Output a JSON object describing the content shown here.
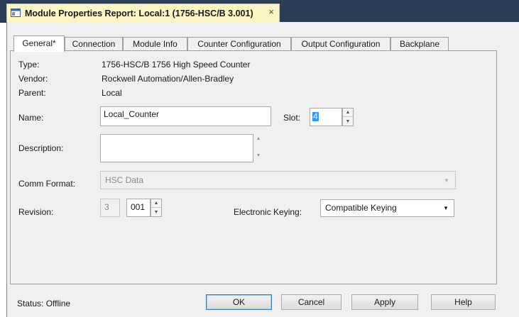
{
  "window": {
    "title": "Module Properties Report: Local:1 (1756-HSC/B 3.001)",
    "close_glyph": "×",
    "icon": "module-properties-icon"
  },
  "tabs": [
    {
      "label": "General*"
    },
    {
      "label": "Connection"
    },
    {
      "label": "Module Info"
    },
    {
      "label": "Counter Configuration"
    },
    {
      "label": "Output Configuration"
    },
    {
      "label": "Backplane"
    }
  ],
  "general": {
    "type_label": "Type:",
    "type_value": "1756-HSC/B 1756 High Speed Counter",
    "vendor_label": "Vendor:",
    "vendor_value": "Rockwell Automation/Allen-Bradley",
    "parent_label": "Parent:",
    "parent_value": "Local",
    "name_label": "Name:",
    "name_value": "Local_Counter",
    "slot_label": "Slot:",
    "slot_value": "4",
    "description_label": "Description:",
    "description_value": "",
    "comm_format_label": "Comm Format:",
    "comm_format_value": "HSC Data",
    "revision_label": "Revision:",
    "revision_major": "3",
    "revision_minor": "001",
    "keying_label": "Electronic Keying:",
    "keying_value": "Compatible Keying"
  },
  "footer": {
    "status_text": "Status:  Offline",
    "ok_label": "OK",
    "cancel_label": "Cancel",
    "apply_label": "Apply",
    "help_label": "Help"
  },
  "colors": {
    "titlebar": "#2a3c56",
    "doc_tab": "#fdf4c3",
    "dialog_bg": "#f0f0f0",
    "selection": "#3399ff"
  }
}
